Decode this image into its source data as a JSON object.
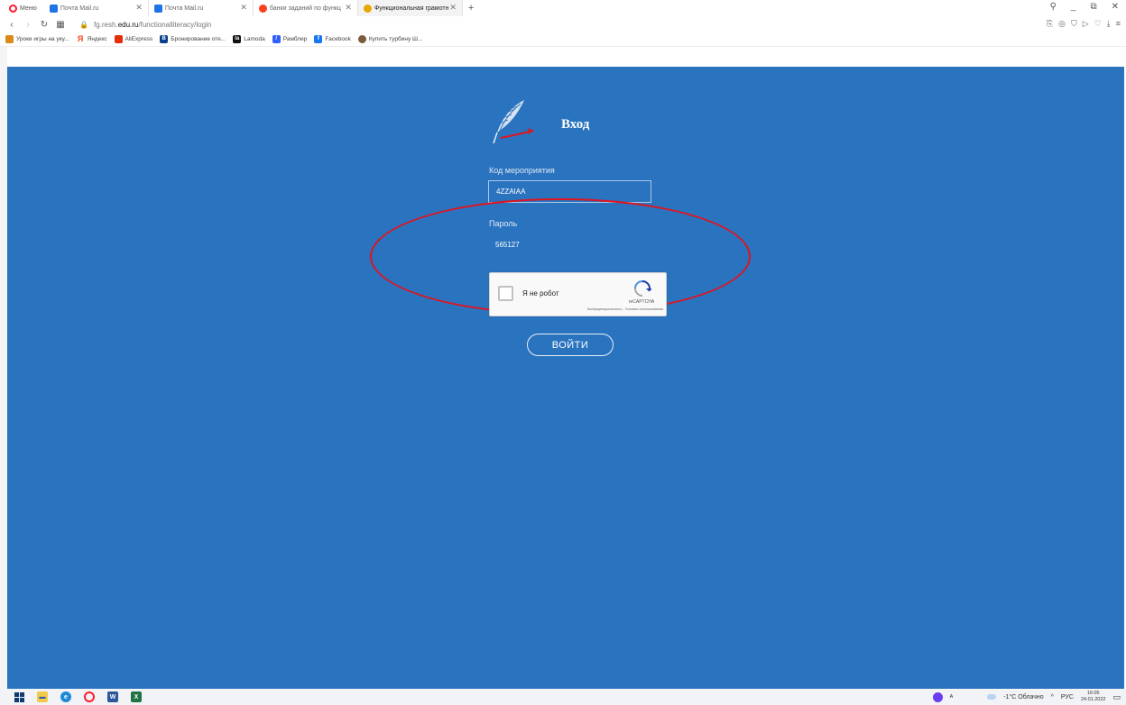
{
  "browser": {
    "menu_label": "Меню",
    "tabs": [
      {
        "label": "Почта Mail.ru",
        "favicon": "mail-icon",
        "color": "#1e73e8"
      },
      {
        "label": "Почта Mail.ru",
        "favicon": "mail-icon",
        "color": "#1e73e8"
      },
      {
        "label": "банки заданий по функц",
        "favicon": "yandex-icon",
        "color": "#fc3f1d"
      },
      {
        "label": "Функциональная грамотн",
        "favicon": "eagle-icon",
        "color": "#e6a700"
      }
    ],
    "new_tab_label": "+",
    "address": {
      "prefix": "fg.resh.",
      "domain": "edu.ru",
      "path": "/functionalliteracy/login"
    },
    "bookmarks": [
      {
        "label": "Уроки игры на уку...",
        "favicon": "guitar-icon",
        "color": "#d98a1a",
        "glyph": ""
      },
      {
        "label": "Яндекс",
        "favicon": "yandex-icon",
        "color": "#fc3f1d",
        "glyph": "Я"
      },
      {
        "label": "AliExpress",
        "favicon": "aliexpress-icon",
        "color": "#e62e04",
        "glyph": ""
      },
      {
        "label": "Бронирование оте...",
        "favicon": "booking-icon",
        "color": "#0b3e8e",
        "glyph": "B"
      },
      {
        "label": "Lamoda",
        "favicon": "lamoda-icon",
        "color": "#111111",
        "glyph": "la"
      },
      {
        "label": "Рамблер",
        "favicon": "rambler-icon",
        "color": "#315efb",
        "glyph": "/"
      },
      {
        "label": "Facebook",
        "favicon": "facebook-icon",
        "color": "#1877f2",
        "glyph": "f"
      },
      {
        "label": "Купить турбину Ш...",
        "favicon": "turbine-icon",
        "color": "#7a5c3a",
        "glyph": ""
      }
    ]
  },
  "login": {
    "title": "Вход",
    "event_code_label": "Код мероприятия",
    "event_code_value": "4ZZAIAA",
    "password_label": "Пароль",
    "password_value": "565127",
    "captcha": {
      "label": "Я не робот",
      "brand": "reCAPTCHA",
      "links": "Конфиденциальность - Условия использования"
    },
    "submit_label": "ВОЙТИ"
  },
  "colors": {
    "page_bg": "#2a73bf",
    "annotation": "#e0141e"
  },
  "taskbar": {
    "weather": "-1°C Облачно",
    "lang": "РУС",
    "time": "16:05",
    "date": "24.01.2022",
    "tray_caret": "^",
    "keyboard_glyph": "ᴬ"
  }
}
